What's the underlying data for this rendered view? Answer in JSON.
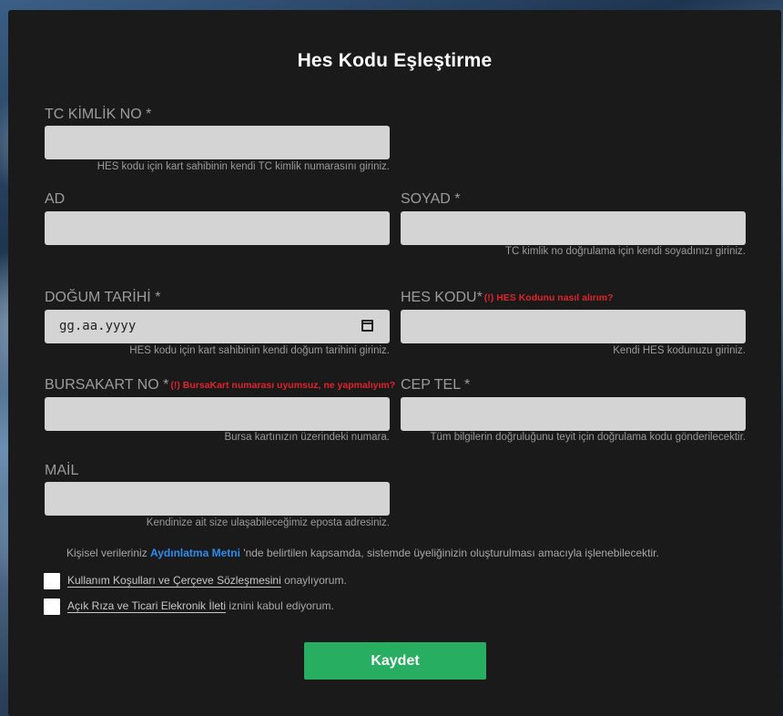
{
  "title": "Hes Kodu Eşleştirme",
  "fields": {
    "tc": {
      "label": "TC KİMLİK NO *",
      "value": "",
      "hint": "HES kodu için kart sahibinin kendi TC kimlik numarasını giriniz."
    },
    "ad": {
      "label": "AD",
      "value": ""
    },
    "soyad": {
      "label": "SOYAD *",
      "value": "",
      "hint": "TC kimlik no doğrulama için kendi soyadınızı giriniz."
    },
    "dogum": {
      "label": "DOĞUM TARİHİ *",
      "placeholder": "gg.aa.yyyy",
      "hint": "HES kodu için kart sahibinin kendi doğum tarihini giriniz."
    },
    "hes": {
      "label": "HES KODU*",
      "warning": "(!) HES Kodunu nasıl alırım?",
      "value": "",
      "hint": "Kendi HES kodunuzu giriniz."
    },
    "bursakart": {
      "label": "BURSAKART NO *",
      "warning": "(!) BursaKart numarası uyumsuz, ne yapmalıyım?",
      "value": "",
      "hint": "Bursa kartınızın üzerindeki numara."
    },
    "ceptel": {
      "label": "CEP TEL *",
      "value": "",
      "hint": "Tüm bilgilerin doğruluğunu teyit için doğrulama kodu gönderilecektir."
    },
    "mail": {
      "label": "MAİL",
      "value": "",
      "hint": "Kendinize ait size ulaşabileceğimiz eposta adresiniz."
    }
  },
  "consent": {
    "prefix": "Kişisel verileriniz ",
    "link": "Aydınlatma Metni",
    "suffix": " 'nde belirtilen kapsamda, sistemde üyeliğinizin oluşturulması amacıyla işlenebilecektir."
  },
  "checks": [
    {
      "link": "Kullanım Koşulları ve Çerçeve Sözleşmesini",
      "text": " onaylıyorum.",
      "checked": false
    },
    {
      "link": "Açık Rıza ve Ticari Elekronik İleti",
      "text": " iznini kabul ediyorum.",
      "checked": false
    }
  ],
  "save_label": "Kaydet"
}
